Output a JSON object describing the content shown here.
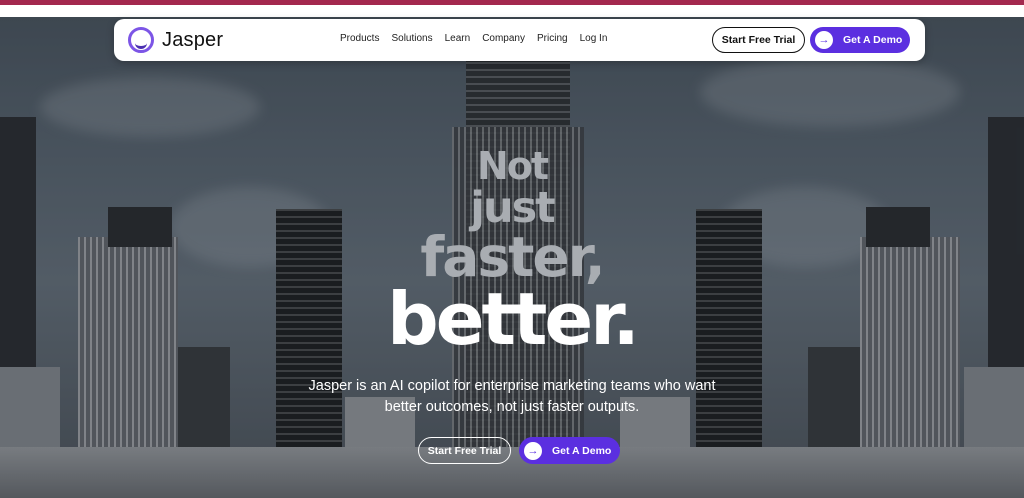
{
  "brand": {
    "name": "Jasper",
    "accent": "#5b2fe0",
    "top_strip_color": "#a3284e"
  },
  "nav": {
    "items": [
      "Products",
      "Solutions",
      "Learn",
      "Company",
      "Pricing",
      "Log In"
    ],
    "start_trial_label": "Start Free Trial",
    "demo_label": "Get A Demo"
  },
  "hero": {
    "line1": "Not",
    "line2": "just",
    "line3": "faster,",
    "line4": "better.",
    "subtitle_line1": "Jasper is an AI copilot for enterprise marketing teams who want",
    "subtitle_line2": "better outcomes, not just faster outputs.",
    "start_trial_label": "Start Free Trial",
    "demo_label": "Get A Demo"
  },
  "icons": {
    "logo": "jasper-logo-icon",
    "arrow": "arrow-right-icon"
  }
}
